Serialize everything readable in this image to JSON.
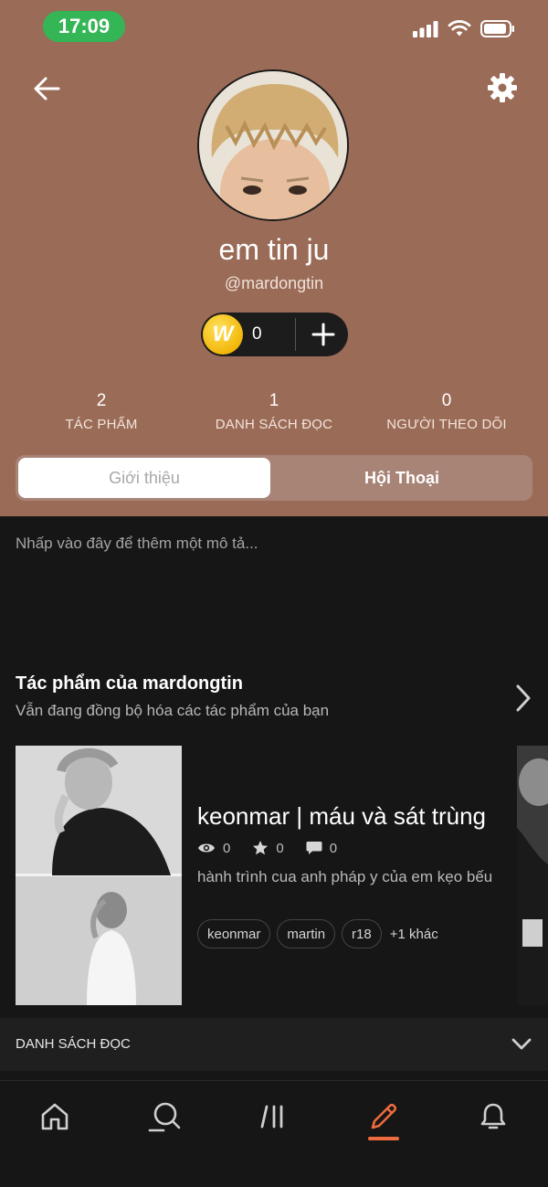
{
  "status_bar": {
    "time": "17:09"
  },
  "profile": {
    "display_name": "em tin ju",
    "username": "@mardongtin",
    "coins": "0"
  },
  "stats": [
    {
      "value": "2",
      "label": "TÁC PHẨM"
    },
    {
      "value": "1",
      "label": "DANH SÁCH ĐỌC"
    },
    {
      "value": "0",
      "label": "NGƯỜI THEO DÕI"
    }
  ],
  "tabs": [
    {
      "label": "Giới thiệu",
      "active": true
    },
    {
      "label": "Hội Thoại",
      "active": false
    }
  ],
  "about": {
    "placeholder": "Nhấp vào đây để thêm một mô tả..."
  },
  "works": {
    "title": "Tác phẩm của mardongtin",
    "subtitle": "Vẫn đang đồng bộ hóa các tác phẩm của bạn",
    "stories": [
      {
        "title": "keonmar | máu và sát trùng",
        "views": "0",
        "votes": "0",
        "comments": "0",
        "description": "hành trình cua anh pháp y của em kẹo bếu",
        "tags": [
          "keonmar",
          "martin",
          "r18"
        ],
        "more_tags": "+1 khác"
      }
    ]
  },
  "reading_list": {
    "label": "DANH SÁCH ĐỌC"
  },
  "bottom_nav": [
    {
      "icon": "home-icon"
    },
    {
      "icon": "search-icon"
    },
    {
      "icon": "library-icon"
    },
    {
      "icon": "write-icon",
      "active": true
    },
    {
      "icon": "notifications-icon"
    }
  ],
  "colors": {
    "header_bg": "#9a6b57",
    "page_bg": "#161616",
    "accent": "#ef6a3e",
    "status_time_bg": "#34b556",
    "coin": "#f2b70a"
  }
}
